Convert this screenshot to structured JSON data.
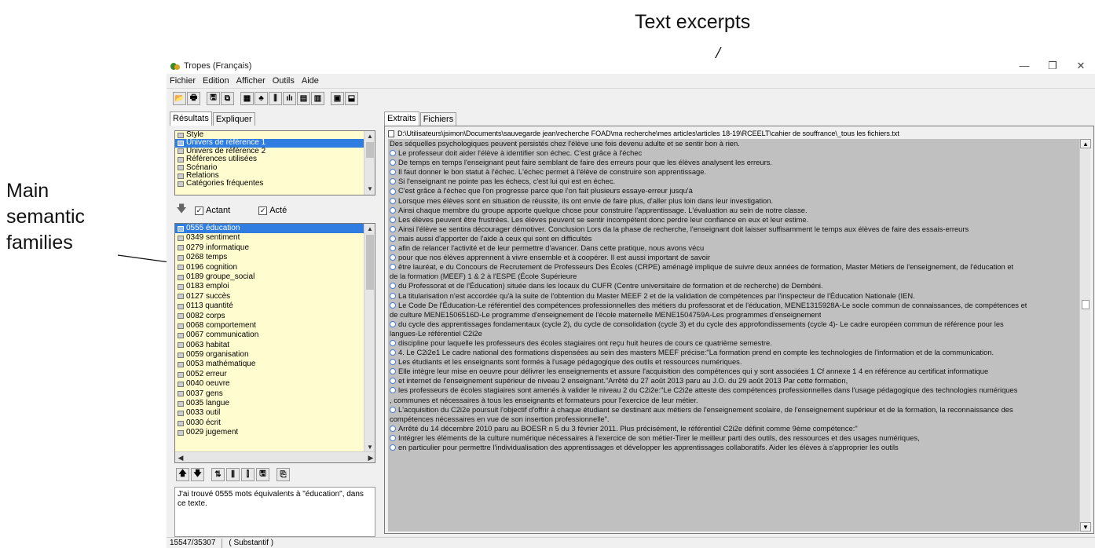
{
  "annotations": {
    "text_excerpts": "Text excerpts",
    "main_semantic_line1": "Main",
    "main_semantic_line2": "semantic",
    "main_semantic_line3": "families"
  },
  "window": {
    "title": "Tropes (Français)",
    "minimize": "—",
    "maximize": "❐",
    "close": "✕"
  },
  "menu": [
    "Fichier",
    "Edition",
    "Afficher",
    "Outils",
    "Aide"
  ],
  "toolbar": [
    "📂",
    "🖶",
    "🖫",
    "⧉",
    "▦",
    "♣",
    "⫼",
    "ılı",
    "▤",
    "▥",
    "▣",
    "⬓"
  ],
  "left_tabs": [
    "Résultats",
    "Expliquer"
  ],
  "results_list": [
    {
      "label": "Style",
      "selected": false
    },
    {
      "label": "Univers de référence 1",
      "selected": true
    },
    {
      "label": "Univers de référence 2",
      "selected": false
    },
    {
      "label": "Références utilisées",
      "selected": false
    },
    {
      "label": "Scénario",
      "selected": false
    },
    {
      "label": "Relations",
      "selected": false
    },
    {
      "label": "Catégories fréquentes",
      "selected": false
    }
  ],
  "checks": {
    "actant_label": "Actant",
    "acte_label": "Acté",
    "actant_checked": true,
    "acte_checked": true
  },
  "families": [
    {
      "label": "0555 éducation",
      "selected": true
    },
    {
      "label": "0349 sentiment"
    },
    {
      "label": "0279 informatique"
    },
    {
      "label": "0268 temps"
    },
    {
      "label": "0196 cognition"
    },
    {
      "label": "0189 groupe_social"
    },
    {
      "label": "0183 emploi"
    },
    {
      "label": "0127 succès"
    },
    {
      "label": "0113 quantité"
    },
    {
      "label": "0082 corps"
    },
    {
      "label": "0068 comportement"
    },
    {
      "label": "0067 communication"
    },
    {
      "label": "0063 habitat"
    },
    {
      "label": "0059 organisation"
    },
    {
      "label": "0053 mathématique"
    },
    {
      "label": "0052 erreur"
    },
    {
      "label": "0040 oeuvre"
    },
    {
      "label": "0037 gens"
    },
    {
      "label": "0035 langue"
    },
    {
      "label": "0033 outil"
    },
    {
      "label": "0030 écrit"
    },
    {
      "label": "0029 jugement"
    }
  ],
  "bottom_buttons": [
    "🡅",
    "🡇",
    "⇅",
    "⫼",
    "⫿",
    "🖫",
    "⎘"
  ],
  "message": "J'ai trouvé 0555 mots équivalents à \"éducation\", dans ce texte.",
  "right_tabs": [
    "Extraits",
    "Fichiers"
  ],
  "file_path": "D:\\Utilisateurs\\jsimon\\Documents\\sauvegarde jean\\recherche FOAD\\ma recherche\\mes articles\\articles 18-19\\RCEELT\\cahier de souffrance\\_tous les fichiers.txt",
  "excerpts": [
    {
      "b": false,
      "t": "Des séquelles psychologiques peuvent persistés chez l'élève une fois devenu adulte  et se sentir bon à rien."
    },
    {
      "b": true,
      "t": "Le professeur doit aider l'élève à identifier son échec. C'est grâce à l'échec"
    },
    {
      "b": true,
      "t": "De temps en temps l'enseignant peut faire semblant de faire des erreurs  pour que les élèves analysent les erreurs."
    },
    {
      "b": true,
      "t": "Il faut donner le bon statut à l'échec. L'échec permet à l'élève de construire son apprentissage."
    },
    {
      "b": true,
      "t": "Si l'enseignant ne pointe pas les échecs, c'est lui  qui est en échec."
    },
    {
      "b": true,
      "t": "C'est grâce à l'échec  que l'on progresse  parce que l'on fait plusieurs essaye-erreur jusqu'à"
    },
    {
      "b": true,
      "t": "Lorsque mes élèves sont en situation de réussite,  ils ont envie de faire plus,  d'aller plus loin dans leur investigation."
    },
    {
      "b": true,
      "t": "Ainsi chaque membre du groupe apporte quelque chose pour construire l'apprentissage. L'évaluation au sein de notre classe."
    },
    {
      "b": true,
      "t": "Les élèves peuvent être frustrées. Les élèves peuvent se sentir incompétent  donc perdre leur confiance en eux et leur estime."
    },
    {
      "b": true,
      "t": "Ainsi l'élève se sentira décourager démotiver. Conclusion Lors da la phase de recherche, l'enseignant doit laisser suffisamment le temps aux élèves de faire des essais-erreurs"
    },
    {
      "b": true,
      "t": "mais aussi d'apporter de l'aide à ceux  qui sont en difficultés"
    },
    {
      "b": true,
      "t": "afin de relancer l'activité  et de leur permettre d'avancer. Dans cette pratique, nous avons vécu"
    },
    {
      "b": true,
      "t": "pour que nos élèves apprennent à vivre ensemble  et à coopérer. Il est aussi important de savoir"
    },
    {
      "b": true,
      "t": "être lauréat, e du Concours de Recrutement de Professeurs Des Écoles (CRPE) aménagé implique de suivre deux années de formation, Master Métiers de l'enseignement, de l'éducation et"
    },
    {
      "b": false,
      "t": "de la formation (MEEF) 1 & 2 à l'ESPE (École Supérieure"
    },
    {
      "b": true,
      "t": "du Professorat et de l'Éducation) située dans les locaux du CUFR (Centre universitaire de formation et de recherche) de Dembéni."
    },
    {
      "b": true,
      "t": "La titularisation n'est accordée qu'à la suite de l'obtention du Master MEEF 2 et de la validation de compétences par l'inspecteur de l'Éducation Nationale (IEN."
    },
    {
      "b": true,
      "t": "Le Code De l'Éducation-Le référentiel des compétences professionnelles des métiers du professorat et de l'éducation, MENE1315928A-Le socle commun de connaissances, de compétences et"
    },
    {
      "b": false,
      "t": "de culture MENE1506516D-Le programme d'enseignement de l'école maternelle MENE1504759A-Les programmes d'enseignement"
    },
    {
      "b": true,
      "t": "du cycle des apprentissages fondamentaux (cycle 2), du cycle de consolidation (cycle 3) et du cycle des approfondissements (cycle 4)- Le cadre européen commun de référence pour les"
    },
    {
      "b": false,
      "t": "langues-Le référentiel C2i2e"
    },
    {
      "b": true,
      "t": "discipline pour laquelle les professeurs des écoles stagiaires ont reçu huit heures de cours ce quatrième semestre."
    },
    {
      "b": true,
      "t": "4. Le C2i2e1 Le cadre national des formations dispensées au sein des masters MEEF précise:\"La formation prend en compte les technologies de l'information et de la communication."
    },
    {
      "b": true,
      "t": "Les étudiants et les enseignants sont formés à l'usage pédagogique des outils et ressources numériques."
    },
    {
      "b": true,
      "t": "Elle intègre leur mise en oeuvre pour délivrer les enseignements  et assure l'acquisition des compétences qui y sont associées 1 Cf annexe 1 4 en référence au certificat informatique"
    },
    {
      "b": true,
      "t": "et internet de l'enseignement supérieur de niveau 2 enseignant.\"Arrêté du 27 août 2013 paru au J.O. du 29 août 2013 Par cette formation,"
    },
    {
      "b": true,
      "t": "les professeurs de écoles stagiaires sont amenés à valider le niveau 2 du C2i2e:\"Le C2i2e atteste des compétences professionnelles dans l'usage pédagogique des technologies numériques"
    },
    {
      "b": false,
      "t": ", communes et nécessaires à tous les enseignants et formateurs pour l'exercice de leur métier."
    },
    {
      "b": true,
      "t": "L'acquisition du C2i2e poursuit l'objectif d'offrir à chaque étudiant se destinant aux métiers de l'enseignement scolaire, de l'enseignement supérieur et de la formation, la reconnaissance des"
    },
    {
      "b": false,
      "t": "compétences nécessaires en vue de son insertion professionnelle\"."
    },
    {
      "b": true,
      "t": "Arrêté du 14 décembre 2010 paru au BOESR n 5 du 3 février 2011. Plus précisément, le référentiel C2i2e définit comme 9ème compétence:\""
    },
    {
      "b": true,
      "t": "Intégrer les éléments de la culture numérique nécessaires à l'exercice de son métier-Tirer le meilleur parti des outils, des ressources et des usages numériques,"
    },
    {
      "b": true,
      "t": "en particulier pour permettre l'individualisation des apprentissages  et développer les apprentissages collaboratifs.  Aider les élèves à s'approprier les outils"
    }
  ],
  "status": {
    "position": "15547/35307",
    "category": "( Substantif )"
  },
  "colors": {
    "highlight": "#1a1aff",
    "selection": "#2f7de1",
    "list_bg": "#fffdd0",
    "text_bg": "#c0c0c0"
  }
}
